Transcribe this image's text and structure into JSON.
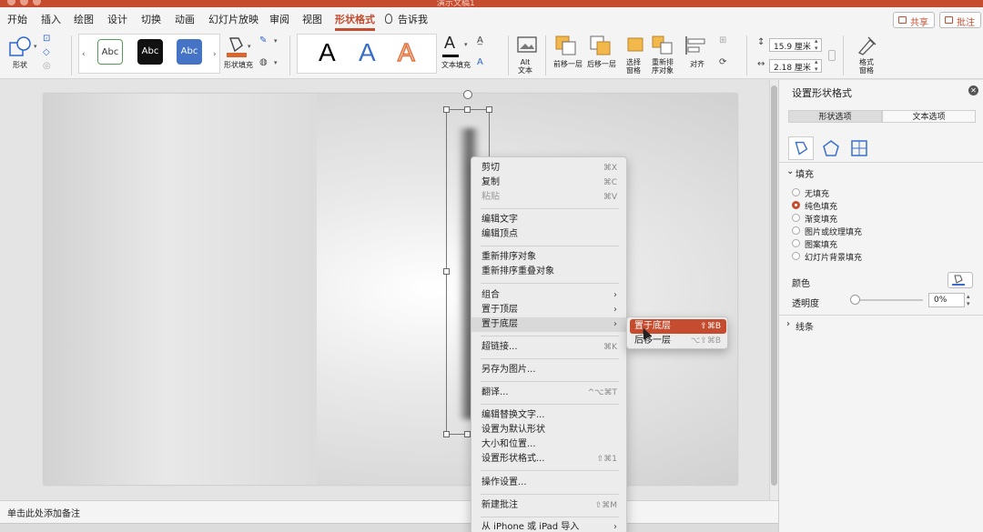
{
  "window": {
    "title": "演示文稿1"
  },
  "tabs": [
    "开始",
    "插入",
    "绘图",
    "设计",
    "切换",
    "动画",
    "幻灯片放映",
    "审阅",
    "视图",
    "形状格式"
  ],
  "tell_me": "告诉我",
  "share_label": "共享",
  "comment_label": "批注",
  "ribbon": {
    "shape_label": "形状",
    "style_chips": [
      "Abc",
      "Abc",
      "Abc"
    ],
    "shape_fill_label": "形状填充",
    "wordart_letter": "A",
    "text_fill_label": "文本填充",
    "alt_text_label": "Alt\n文本",
    "bring_forward_label": "前移一层",
    "send_backward_label": "后移一层",
    "selection_pane_label": "选择\n窗格",
    "reorder_label": "重新排\n序对象",
    "align_label": "对齐",
    "height_value": "15.9 厘米",
    "width_value": "2.18 厘米",
    "format_pane_label": "格式\n窗格",
    "colors": {
      "accent": "#c64c2f",
      "chip_blue": "#4574c6"
    }
  },
  "notes_placeholder": "单击此处添加备注",
  "context_menu": {
    "items": [
      {
        "label": "剪切",
        "shortcut": "⌘X",
        "disabled": false
      },
      {
        "label": "复制",
        "shortcut": "⌘C",
        "disabled": false
      },
      {
        "label": "粘贴",
        "shortcut": "⌘V",
        "disabled": true
      },
      {
        "label": "编辑文字",
        "shortcut": "",
        "disabled": false
      },
      {
        "label": "编辑顶点",
        "shortcut": "",
        "disabled": false
      },
      {
        "label": "重新排序对象",
        "shortcut": "",
        "disabled": false
      },
      {
        "label": "重新排序重叠对象",
        "shortcut": "",
        "disabled": false
      },
      {
        "label": "组合",
        "shortcut": "›",
        "disabled": false
      },
      {
        "label": "置于顶层",
        "shortcut": "›",
        "disabled": false
      },
      {
        "label": "置于底层",
        "shortcut": "›",
        "disabled": false,
        "highlighted": true
      },
      {
        "label": "超链接...",
        "shortcut": "⌘K",
        "disabled": false
      },
      {
        "label": "另存为图片...",
        "shortcut": "",
        "disabled": false
      },
      {
        "label": "翻译...",
        "shortcut": "^⌥⌘T",
        "disabled": false
      },
      {
        "label": "编辑替换文字...",
        "shortcut": "",
        "disabled": false
      },
      {
        "label": "设置为默认形状",
        "shortcut": "",
        "disabled": false
      },
      {
        "label": "大小和位置...",
        "shortcut": "",
        "disabled": false
      },
      {
        "label": "设置形状格式...",
        "shortcut": "⇧⌘1",
        "disabled": false
      },
      {
        "label": "操作设置...",
        "shortcut": "",
        "disabled": false
      },
      {
        "label": "新建批注",
        "shortcut": "⇧⌘M",
        "disabled": false
      },
      {
        "label": "从 iPhone 或 iPad 导入",
        "shortcut": "›",
        "disabled": false
      }
    ]
  },
  "submenu": {
    "items": [
      {
        "label": "置于底层",
        "shortcut": "⇧⌘B",
        "highlighted": true
      },
      {
        "label": "后移一层",
        "shortcut": "⌥⇧⌘B",
        "highlighted": false
      }
    ]
  },
  "format_pane": {
    "title": "设置形状格式",
    "tab_shape": "形状选项",
    "tab_text": "文本选项",
    "fill_header": "填充",
    "fill_options": [
      "无填充",
      "纯色填充",
      "渐变填充",
      "图片或纹理填充",
      "图案填充",
      "幻灯片背景填充"
    ],
    "selected_fill": 1,
    "color_label": "颜色",
    "transparency_label": "透明度",
    "transparency_value": "0%",
    "line_header": "线条"
  }
}
